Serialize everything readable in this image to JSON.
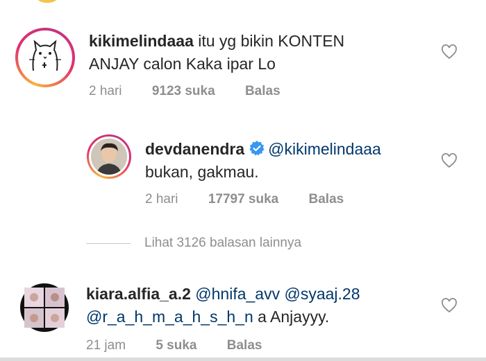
{
  "comments": [
    {
      "username": "kikimelindaaa",
      "text_line1": " itu yg bikin KONTEN",
      "text_line2": "ANJAY calon Kaka ipar Lo",
      "time": "2 hari",
      "likes": "9123 suka",
      "reply_label": "Balas",
      "avatar_icon": "cat-drawing-icon"
    },
    {
      "username": "devdanendra",
      "verified": true,
      "mention": "@kikimelindaaa",
      "text_line2": "bukan, gakmau.",
      "time": "2 hari",
      "likes": "17797 suka",
      "reply_label": "Balas",
      "avatar_icon": "profile-photo-icon"
    },
    {
      "username": "kiara.alfia_a.2",
      "mention1": "@hnifa_avv",
      "mention2": "@syaaj.28",
      "mention3": "@r_a_h_m_a_h_s_h_n",
      "text_tail": " a Anjayyy.",
      "time": "21 jam",
      "likes": "5 suka",
      "reply_label": "Balas",
      "avatar_icon": "collage-photo-icon"
    }
  ],
  "view_more_replies": "Lihat 3126 balasan lainnya",
  "colors": {
    "story_ring": [
      "#f9b33a",
      "#e1306c",
      "#c13584"
    ],
    "mention": "#00376b",
    "secondary_text": "#8e8e8e",
    "verified_badge": "#3897f0"
  }
}
